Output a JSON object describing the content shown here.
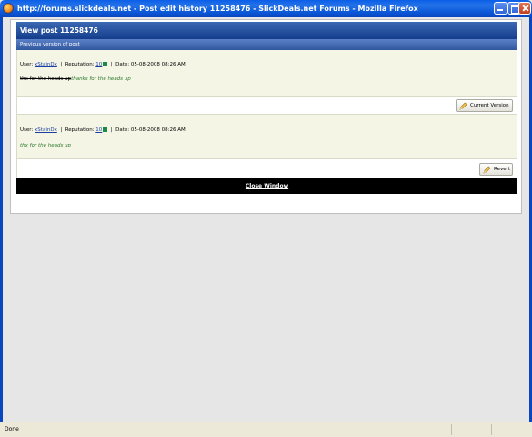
{
  "window": {
    "title": "http://forums.slickdeals.net - Post edit history 11258476 - SlickDeals.net Forums - Mozilla Firefox"
  },
  "panel": {
    "header": "View post 11258476",
    "subheader": "Previous version of post"
  },
  "posts": [
    {
      "user_label": "User:",
      "user_name": "xStainDx",
      "sep1": "|",
      "rep_label": "Reputation:",
      "rep_value": "10",
      "sep2": "|",
      "date_label": "Date:",
      "date_value": "05-08-2008 08:26 AM",
      "body_strike": "thx for the heads up",
      "body_green": "thanks for the heads up",
      "action_label": "Current Version"
    },
    {
      "user_label": "User:",
      "user_name": "xStainDx",
      "sep1": "|",
      "rep_label": "Reputation:",
      "rep_value": "10",
      "sep2": "|",
      "date_label": "Date:",
      "date_value": "05-08-2008 08:26 AM",
      "body_green": "thx for the heads up",
      "action_label": "Revert"
    }
  ],
  "close_label": "Close Window",
  "status": {
    "text": "Done"
  },
  "colors": {
    "header_blue": "#143d8b",
    "post_bg": "#f5f5e6",
    "green_text": "#2a7a2a",
    "link_blue": "#1b3fa0"
  }
}
